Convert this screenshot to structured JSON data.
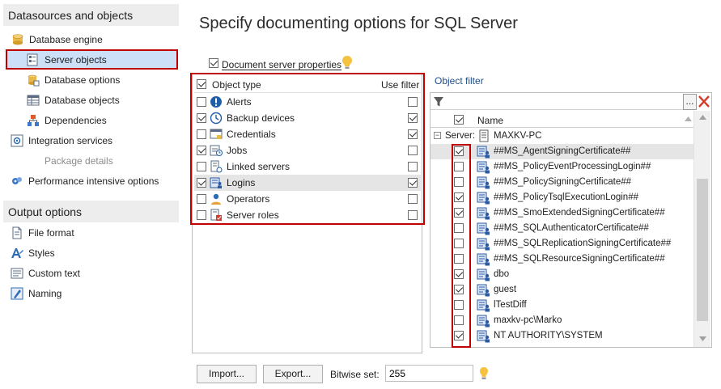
{
  "page_title": "Specify documenting options for SQL Server",
  "sidebar": {
    "section1_title": "Datasources and objects",
    "section2_title": "Output options",
    "items": [
      {
        "label": "Database engine",
        "icon": "database-icon"
      },
      {
        "label": "Server objects",
        "icon": "server-objects-icon",
        "selected": true
      },
      {
        "label": "Database options",
        "icon": "database-options-icon"
      },
      {
        "label": "Database objects",
        "icon": "database-objects-icon"
      },
      {
        "label": "Dependencies",
        "icon": "dependencies-icon"
      },
      {
        "label": "Integration services",
        "icon": "integration-services-icon"
      },
      {
        "label": "Package details",
        "icon": "none",
        "disabled": true
      },
      {
        "label": "Performance intensive options",
        "icon": "performance-icon"
      },
      {
        "label": "File format",
        "icon": "file-format-icon"
      },
      {
        "label": "Styles",
        "icon": "styles-icon"
      },
      {
        "label": "Custom text",
        "icon": "custom-text-icon"
      },
      {
        "label": "Naming",
        "icon": "naming-icon"
      }
    ]
  },
  "document_server_properties": {
    "label": "Document server properties",
    "checked": true
  },
  "object_types": {
    "header_label": "Object type",
    "use_filter_label": "Use filter",
    "rows": [
      {
        "label": "Alerts",
        "checked": false,
        "use_filter": false,
        "icon": "alerts-icon"
      },
      {
        "label": "Backup devices",
        "checked": true,
        "use_filter": true,
        "icon": "backup-devices-icon"
      },
      {
        "label": "Credentials",
        "checked": false,
        "use_filter": true,
        "icon": "credentials-icon"
      },
      {
        "label": "Jobs",
        "checked": true,
        "use_filter": false,
        "icon": "jobs-icon"
      },
      {
        "label": "Linked servers",
        "checked": false,
        "use_filter": false,
        "icon": "linked-servers-icon"
      },
      {
        "label": "Logins",
        "checked": true,
        "use_filter": true,
        "icon": "logins-icon",
        "selected": true
      },
      {
        "label": "Operators",
        "checked": false,
        "use_filter": false,
        "icon": "operators-icon"
      },
      {
        "label": "Server roles",
        "checked": false,
        "use_filter": false,
        "icon": "server-roles-icon"
      }
    ]
  },
  "object_filter": {
    "title": "Object filter",
    "search_value": "",
    "ellipsis_label": "...",
    "name_header": "Name",
    "group_toggle": "−",
    "server_label": "Server:",
    "server_name": "MAXKV-PC",
    "rows": [
      {
        "name": "##MS_AgentSigningCertificate##",
        "checked": true,
        "selected": true
      },
      {
        "name": "##MS_PolicyEventProcessingLogin##",
        "checked": false
      },
      {
        "name": "##MS_PolicySigningCertificate##",
        "checked": false
      },
      {
        "name": "##MS_PolicyTsqlExecutionLogin##",
        "checked": true
      },
      {
        "name": "##MS_SmoExtendedSigningCertificate##",
        "checked": true
      },
      {
        "name": "##MS_SQLAuthenticatorCertificate##",
        "checked": false
      },
      {
        "name": "##MS_SQLReplicationSigningCertificate##",
        "checked": false
      },
      {
        "name": "##MS_SQLResourceSigningCertificate##",
        "checked": false
      },
      {
        "name": "dbo",
        "checked": true
      },
      {
        "name": "guest",
        "checked": true
      },
      {
        "name": "lTestDiff",
        "checked": false
      },
      {
        "name": "maxkv-pc\\Marko",
        "checked": false
      },
      {
        "name": "NT AUTHORITY\\SYSTEM",
        "checked": true
      }
    ]
  },
  "bottom": {
    "import_label": "Import...",
    "export_label": "Export...",
    "bitwise_label": "Bitwise set:",
    "bitwise_value": "255"
  },
  "colors": {
    "accent_red": "#c00000",
    "selection_blue": "#cce0f7",
    "link_blue": "#1e4e8c"
  }
}
